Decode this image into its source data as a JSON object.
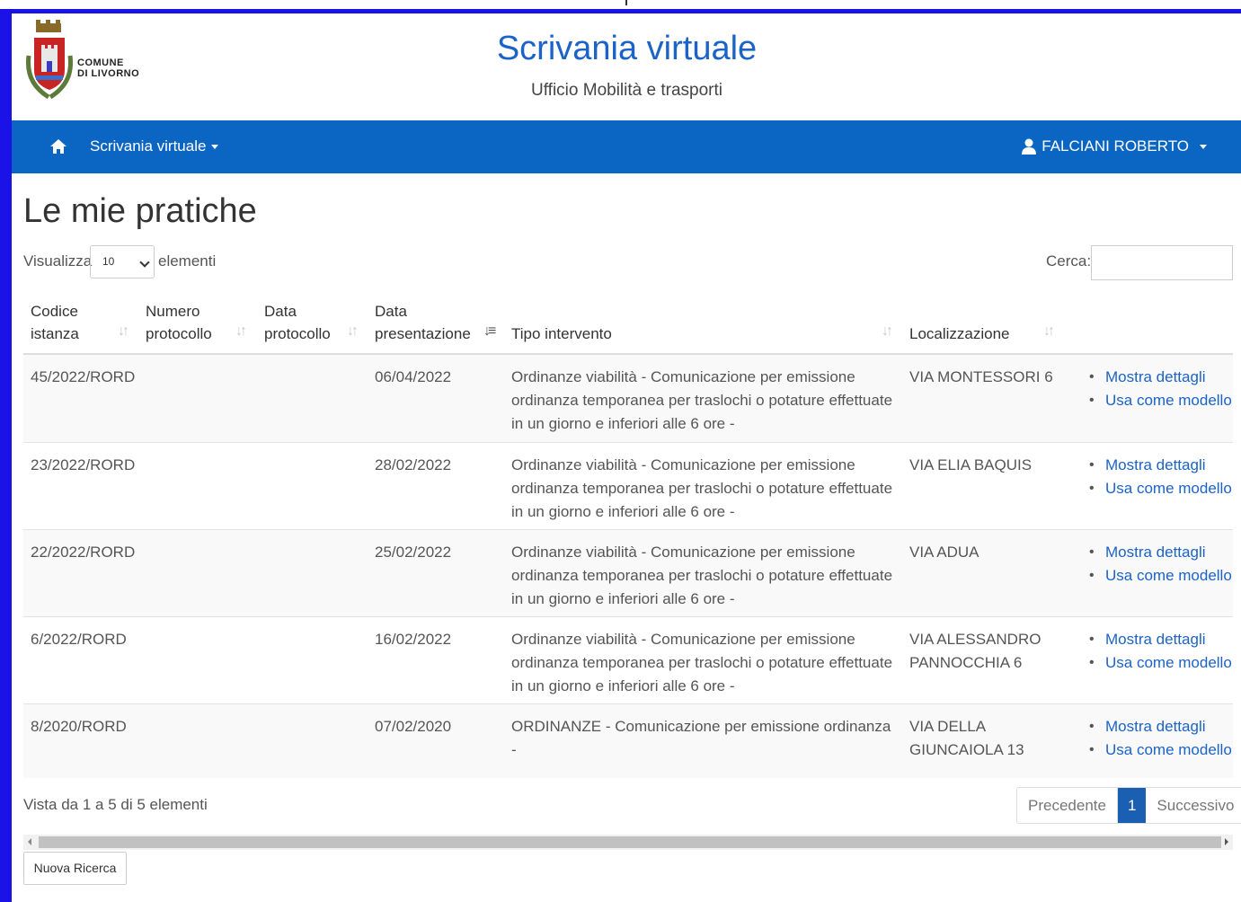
{
  "header": {
    "logo_line1": "COMUNE",
    "logo_line2": "DI LIVORNO",
    "title": "Scrivania virtuale",
    "subtitle": "Ufficio Mobilità e trasporti"
  },
  "navbar": {
    "home_icon": "home-icon",
    "menu_label": "Scrivania virtuale",
    "user_icon": "user-icon",
    "user_label": "FALCIANI ROBERTO",
    "background": "#0b66c3"
  },
  "page": {
    "title": "Le mie pratiche"
  },
  "controls": {
    "show_label": "Visualizza",
    "page_length": "10",
    "show_after": "elementi",
    "search_label": "Cerca:",
    "search_value": ""
  },
  "table": {
    "columns": [
      {
        "line1": "Codice",
        "line2": "istanza"
      },
      {
        "line1": "Numero",
        "line2": "protocollo"
      },
      {
        "line1": "Data",
        "line2": "protocollo"
      },
      {
        "line1": "Data",
        "line2": "presentazione"
      },
      {
        "line1": "",
        "line2": "Tipo intervento"
      },
      {
        "line1": "",
        "line2": "Localizzazione"
      }
    ],
    "rows": [
      {
        "codice": "45/2022/RORD",
        "numero": "",
        "data_protocollo": "",
        "data_presentazione": "06/04/2022",
        "tipo": "Ordinanze viabilità - Comunicazione per emissione ordinanza temporanea per traslochi o potature effettuate in un giorno e inferiori alle 6 ore -",
        "localizzazione": "VIA MONTESSORI 6",
        "action1": "Mostra dettagli",
        "action2": "Usa come modello"
      },
      {
        "codice": "23/2022/RORD",
        "numero": "",
        "data_protocollo": "",
        "data_presentazione": "28/02/2022",
        "tipo": "Ordinanze viabilità - Comunicazione per emissione ordinanza temporanea per traslochi o potature effettuate in un giorno e inferiori alle 6 ore -",
        "localizzazione": "VIA ELIA BAQUIS",
        "action1": "Mostra dettagli",
        "action2": "Usa come modello"
      },
      {
        "codice": "22/2022/RORD",
        "numero": "",
        "data_protocollo": "",
        "data_presentazione": "25/02/2022",
        "tipo": "Ordinanze viabilità - Comunicazione per emissione ordinanza temporanea per traslochi o potature effettuate in un giorno e inferiori alle 6 ore -",
        "localizzazione": "VIA ADUA",
        "action1": "Mostra dettagli",
        "action2": "Usa come modello"
      },
      {
        "codice": "6/2022/RORD",
        "numero": "",
        "data_protocollo": "",
        "data_presentazione": "16/02/2022",
        "tipo": "Ordinanze viabilità - Comunicazione per emissione ordinanza temporanea per traslochi o potature effettuate in un giorno e inferiori alle 6 ore -",
        "localizzazione": "VIA ALESSANDRO PANNOCCHIA 6",
        "action1": "Mostra dettagli",
        "action2": "Usa come modello"
      },
      {
        "codice": "8/2020/RORD",
        "numero": "",
        "data_protocollo": "",
        "data_presentazione": "07/02/2020",
        "tipo": "ORDINANZE - Comunicazione per emissione ordinanza -",
        "localizzazione": "VIA DELLA GIUNCAIOLA 13",
        "action1": "Mostra dettagli",
        "action2": "Usa come modello"
      }
    ]
  },
  "footer": {
    "info": "Vista da 1 a 5 di 5 elementi",
    "prev": "Precedente",
    "current_page": "1",
    "next": "Successivo",
    "new_search": "Nuova Ricerca"
  }
}
